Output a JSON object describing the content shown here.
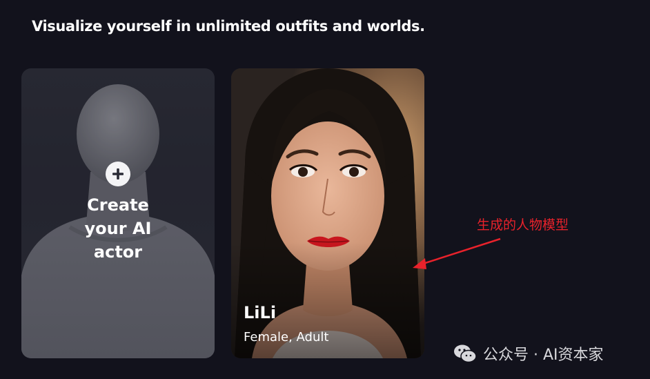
{
  "header": {
    "title": "Visualize yourself in unlimited outfits and worlds."
  },
  "create_card": {
    "label": "Create\nyour AI\nactor"
  },
  "actor_card": {
    "name": "LiLi",
    "meta": "Female, Adult"
  },
  "annotation": {
    "text": "生成的人物模型",
    "color": "#e8222b"
  },
  "watermark": {
    "text": "公众号 · AI资本家"
  },
  "colors": {
    "background": "#12121c",
    "card_dark": "#2a2b36",
    "text_primary": "#ffffff"
  }
}
